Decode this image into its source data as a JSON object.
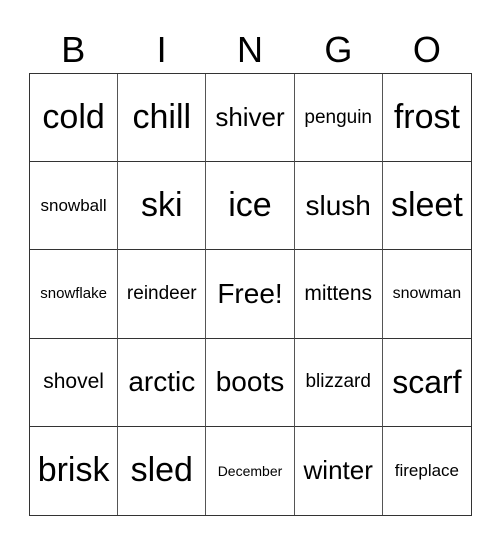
{
  "header": [
    "B",
    "I",
    "N",
    "G",
    "O"
  ],
  "cells": [
    [
      "cold",
      "chill",
      "shiver",
      "penguin",
      "frost"
    ],
    [
      "snowball",
      "ski",
      "ice",
      "slush",
      "sleet"
    ],
    [
      "snowflake",
      "reindeer",
      "Free!",
      "mittens",
      "snowman"
    ],
    [
      "shovel",
      "arctic",
      "boots",
      "blizzard",
      "scarf"
    ],
    [
      "brisk",
      "sled",
      "December",
      "winter",
      "fireplace"
    ]
  ]
}
